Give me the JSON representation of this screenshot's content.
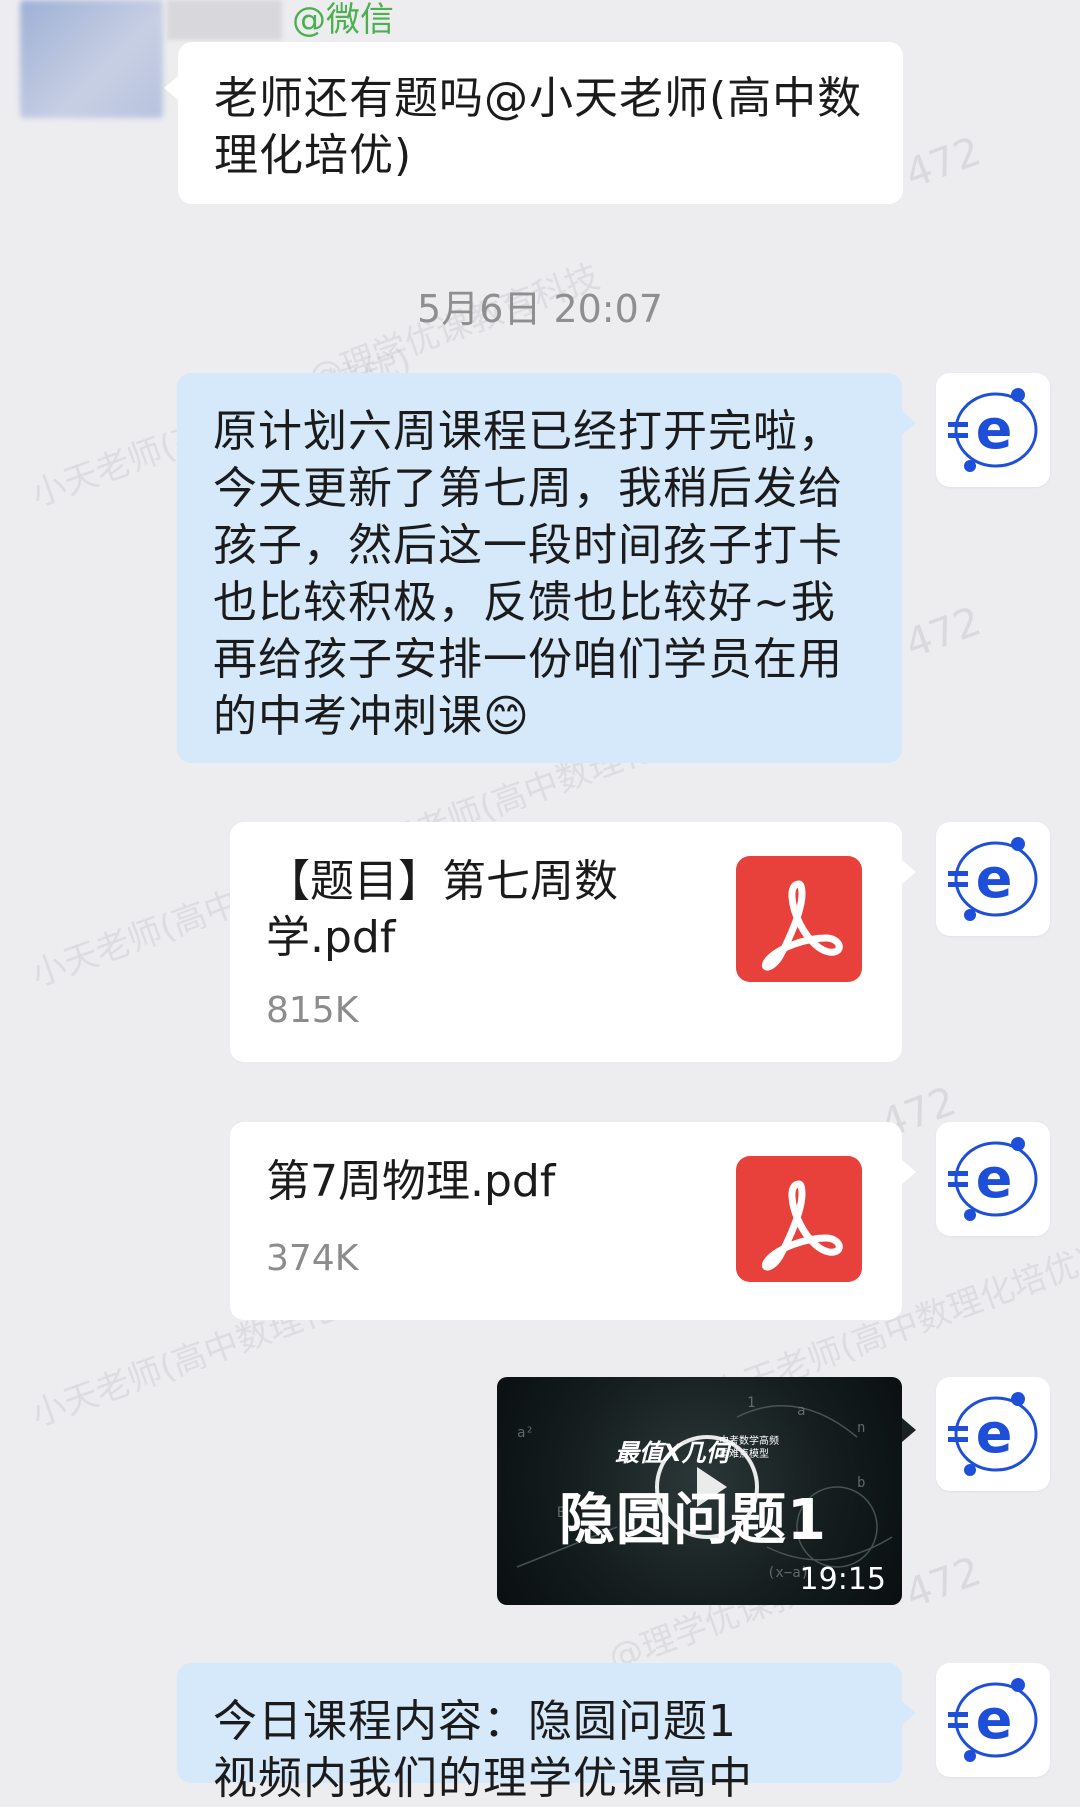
{
  "colors": {
    "background": "#ededf0",
    "incoming_bubble": "#ffffff",
    "outgoing_bubble": "#d5e9fb",
    "pdf_icon": "#e8403a",
    "wechat_tag": "#4caf50",
    "avatar_accent": "#1e4fd8"
  },
  "top": {
    "source_tag": "@微信"
  },
  "messages": {
    "incoming_text": "老师还有题吗@小天老师(高中数理化培优)",
    "timestamp": "5月6日 20:07",
    "outgoing_text": "原计划六周课程已经打开完啦，今天更新了第七周，我稍后发给孩子，然后这一段时间孩子打卡也比较积极，反馈也比较好~我再给孩子安排一份咱们学员在用的中考冲刺课😊",
    "file1": {
      "name": "【题目】第七周数学.pdf",
      "size": "815K",
      "icon": "pdf-icon"
    },
    "file2": {
      "name": "第7周物理.pdf",
      "size": "374K",
      "icon": "pdf-icon"
    },
    "video": {
      "small_title": "最值X几何",
      "tag": "中考数学高频重难点模型",
      "main_title": "隐圆问题1",
      "duration": "19:15",
      "icon": "play-icon"
    },
    "last_text_line1": "今日课程内容：隐圆问题1",
    "last_text_line2": "视频内我们的理学优课高中"
  },
  "watermark": {
    "text_a": "小天老师(高中数理化培优)",
    "text_b": "@理学优课教育科技",
    "number": "472"
  },
  "avatar": {
    "icon": "e-logo-icon"
  }
}
